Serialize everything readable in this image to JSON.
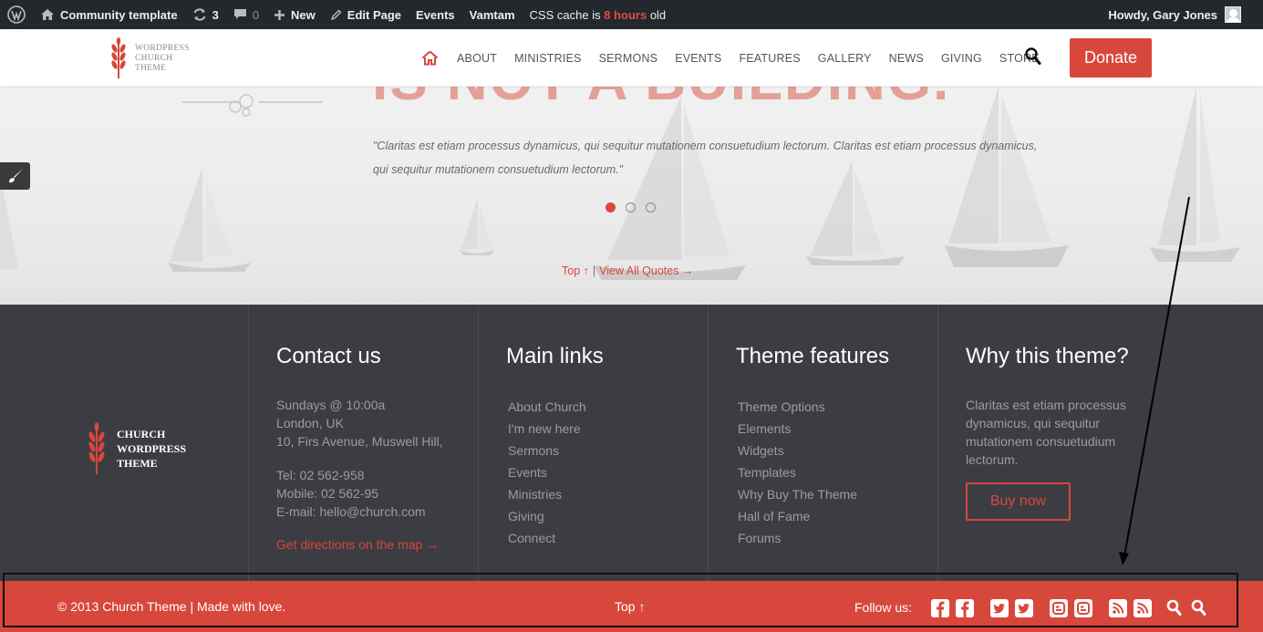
{
  "admin_bar": {
    "site_name": "Community template",
    "updates_count": "3",
    "comments_count": "0",
    "new_label": "New",
    "edit_page_label": "Edit Page",
    "events_label": "Events",
    "vamtam_label": "Vamtam",
    "cache_prefix": "CSS cache is",
    "cache_age": "8 hours",
    "cache_suffix": "old",
    "greeting": "Howdy, Gary Jones"
  },
  "header": {
    "logo_lines": [
      "WordPress",
      "Church",
      "Theme"
    ],
    "nav_items": [
      "ABOUT",
      "MINISTRIES",
      "SERMONS",
      "EVENTS",
      "FEATURES",
      "GALLERY",
      "NEWS",
      "GIVING",
      "STORE"
    ],
    "donate_label": "Donate"
  },
  "hero": {
    "heading": "IS NOT A BUILDING.",
    "quote_line1": "\"Claritas est etiam processus dynamicus, qui sequitur mutationem consuetudium lectorum. Claritas est etiam processus dynamicus,",
    "quote_line2": "qui sequitur mutationem consuetudium lectorum.\"",
    "slides_total": 3,
    "active_slide": 1,
    "top_link": "Top ↑",
    "separator": "|",
    "view_all_link": "View All Quotes →"
  },
  "footer": {
    "logo_lines": [
      "Church",
      "WordPress",
      "Theme"
    ],
    "contact": {
      "title": "Contact us",
      "address": [
        "Sundays @ 10:00a",
        "London, UK",
        "10, Firs Avenue, Muswell Hill,"
      ],
      "phones": [
        "Tel: 02 562-958",
        "Mobile: 02 562-95",
        "E-mail: hello@church.com"
      ],
      "directions": "Get directions on the map →"
    },
    "main_links": {
      "title": "Main links",
      "items": [
        "About Church",
        "I'm new here",
        "Sermons",
        "Events",
        "Ministries",
        "Giving",
        "Connect"
      ]
    },
    "theme_features": {
      "title": "Theme features",
      "items": [
        "Theme Options",
        "Elements",
        "Widgets",
        "Templates",
        "Why Buy The Theme",
        "Hall of Fame",
        "Forums"
      ]
    },
    "why": {
      "title": "Why this theme?",
      "lines": [
        "Claritas est etiam processus",
        "dynamicus, qui sequitur",
        "mutationem consuetudium",
        "lectorum."
      ],
      "button": "Buy now"
    }
  },
  "bottom_bar": {
    "copyright": "© 2013 Church Theme | Made with love.",
    "top": "Top ↑",
    "follow": "Follow us:",
    "icons": [
      "facebook-icon",
      "facebook-icon",
      "twitter-icon",
      "twitter-icon",
      "blogger-icon",
      "blogger-icon",
      "rss-icon",
      "rss-icon",
      "search-icon",
      "search-icon"
    ]
  },
  "colors": {
    "accent": "#d8473c",
    "admin_bar": "#23282d",
    "footer_bg": "#3b3d42"
  }
}
